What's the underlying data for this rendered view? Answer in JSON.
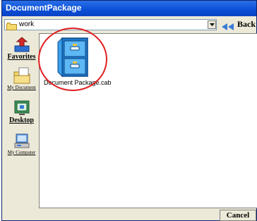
{
  "window": {
    "title": "DocumentPackage"
  },
  "address": {
    "path": "work"
  },
  "toolbar": {
    "back_label": "Back"
  },
  "sidebar": {
    "items": [
      {
        "label": "Favorites",
        "icon": "favorites-icon"
      },
      {
        "label": "My Document",
        "icon": "my-documents-icon"
      },
      {
        "label": "Desktop",
        "icon": "desktop-icon"
      },
      {
        "label": "My Computer",
        "icon": "my-computer-icon"
      }
    ]
  },
  "files": [
    {
      "name": "Document Package.cab",
      "icon": "file-cabinet-icon"
    }
  ],
  "footer": {
    "cancel_label": "Cancel"
  },
  "colors": {
    "titlebar": "#0a4fd6",
    "highlight": "#e02020",
    "back_arrow": "#3a7bd5"
  }
}
